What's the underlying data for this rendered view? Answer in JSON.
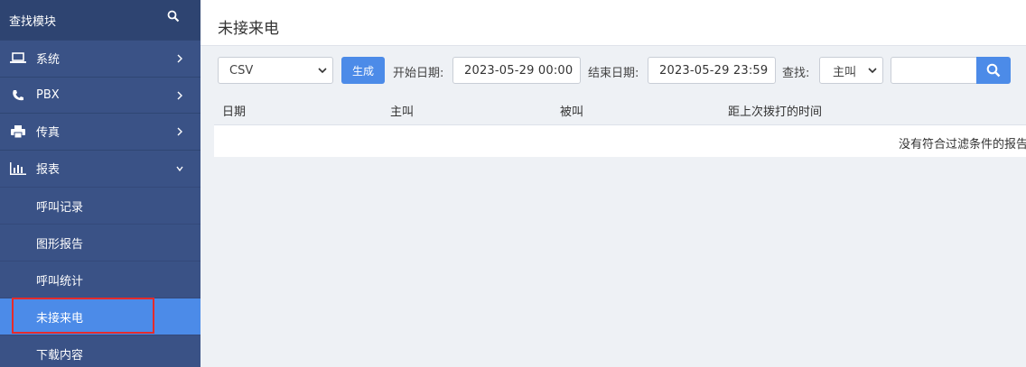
{
  "sidebar": {
    "search_label": "查找模块",
    "items": [
      {
        "label": "系统",
        "icon": "laptop-icon"
      },
      {
        "label": "PBX",
        "icon": "phone-icon"
      },
      {
        "label": "传真",
        "icon": "printer-icon"
      },
      {
        "label": "报表",
        "icon": "bar-chart-icon"
      }
    ],
    "sub_items": [
      {
        "label": "呼叫记录"
      },
      {
        "label": "图形报告"
      },
      {
        "label": "呼叫统计"
      },
      {
        "label": "未接来电",
        "active": true
      },
      {
        "label": "下载内容"
      }
    ]
  },
  "header": {
    "title": "未接来电"
  },
  "toolbar": {
    "format_select": "CSV",
    "generate_label": "生成",
    "start_label": "开始日期:",
    "start_value": "2023-05-29 00:00",
    "end_label": "结束日期:",
    "end_value": "2023-05-29 23:59",
    "find_label": "查找:",
    "find_select": "主叫",
    "search_value": ""
  },
  "table": {
    "columns": [
      "日期",
      "主叫",
      "被叫",
      "距上次拨打的时间"
    ],
    "empty_message": "没有符合过滤条件的报告"
  },
  "colors": {
    "sidebar": "#3a5286",
    "accent": "#4c8be8",
    "highlight": "#e52b2b"
  }
}
